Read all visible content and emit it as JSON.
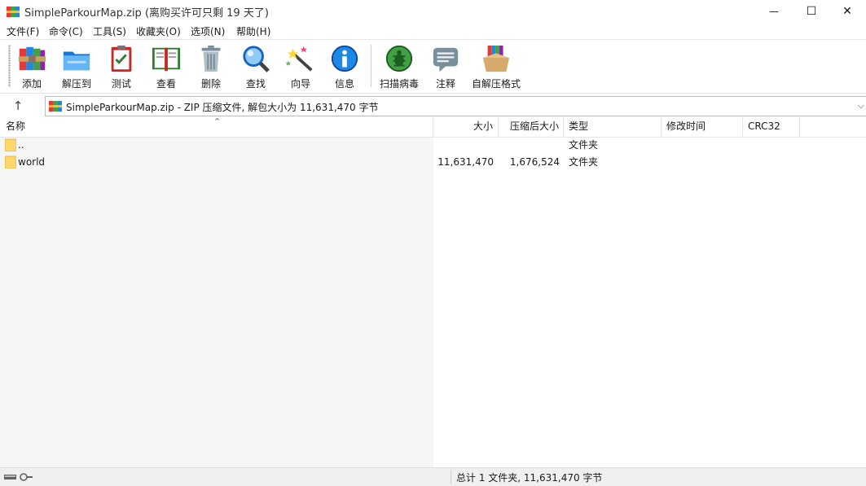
{
  "window": {
    "title": "SimpleParkourMap.zip (离购买许可只剩 19 天了)",
    "minimize_glyph": "—",
    "maximize_glyph": "☐",
    "close_glyph": "✕"
  },
  "menu": [
    "文件(F)",
    "命令(C)",
    "工具(S)",
    "收藏夹(O)",
    "选项(N)",
    "帮助(H)"
  ],
  "toolbar": [
    {
      "label": "添加",
      "icon": "books-add-icon"
    },
    {
      "label": "解压到",
      "icon": "folder-extract-icon"
    },
    {
      "label": "测试",
      "icon": "clipboard-test-icon"
    },
    {
      "label": "查看",
      "icon": "book-view-icon"
    },
    {
      "label": "删除",
      "icon": "trash-icon"
    },
    {
      "label": "查找",
      "icon": "magnifier-icon"
    },
    {
      "label": "向导",
      "icon": "wizard-wand-icon"
    },
    {
      "label": "信息",
      "icon": "info-icon"
    },
    {
      "label": "扫描病毒",
      "icon": "virus-scan-icon"
    },
    {
      "label": "注释",
      "icon": "comment-icon"
    },
    {
      "label": "自解压格式",
      "icon": "sfx-box-icon"
    }
  ],
  "address": {
    "up_glyph": "↑",
    "path": "SimpleParkourMap.zip - ZIP 压缩文件, 解包大小为 11,631,470 字节",
    "dropdown_glyph": "⌵"
  },
  "columns": {
    "name": "名称",
    "size": "大小",
    "packed": "压缩后大小",
    "type": "类型",
    "modified": "修改时间",
    "crc": "CRC32"
  },
  "sort_glyph": "⌃",
  "rows": [
    {
      "name": "..",
      "size": "",
      "packed": "",
      "type": "文件夹"
    },
    {
      "name": "world",
      "size": "11,631,470",
      "packed": "1,676,524",
      "type": "文件夹"
    }
  ],
  "status": {
    "summary": "总计 1 文件夹, 11,631,470 字节"
  },
  "colors": {
    "folder": "#ffd66b",
    "accent": "#1e88e5"
  }
}
